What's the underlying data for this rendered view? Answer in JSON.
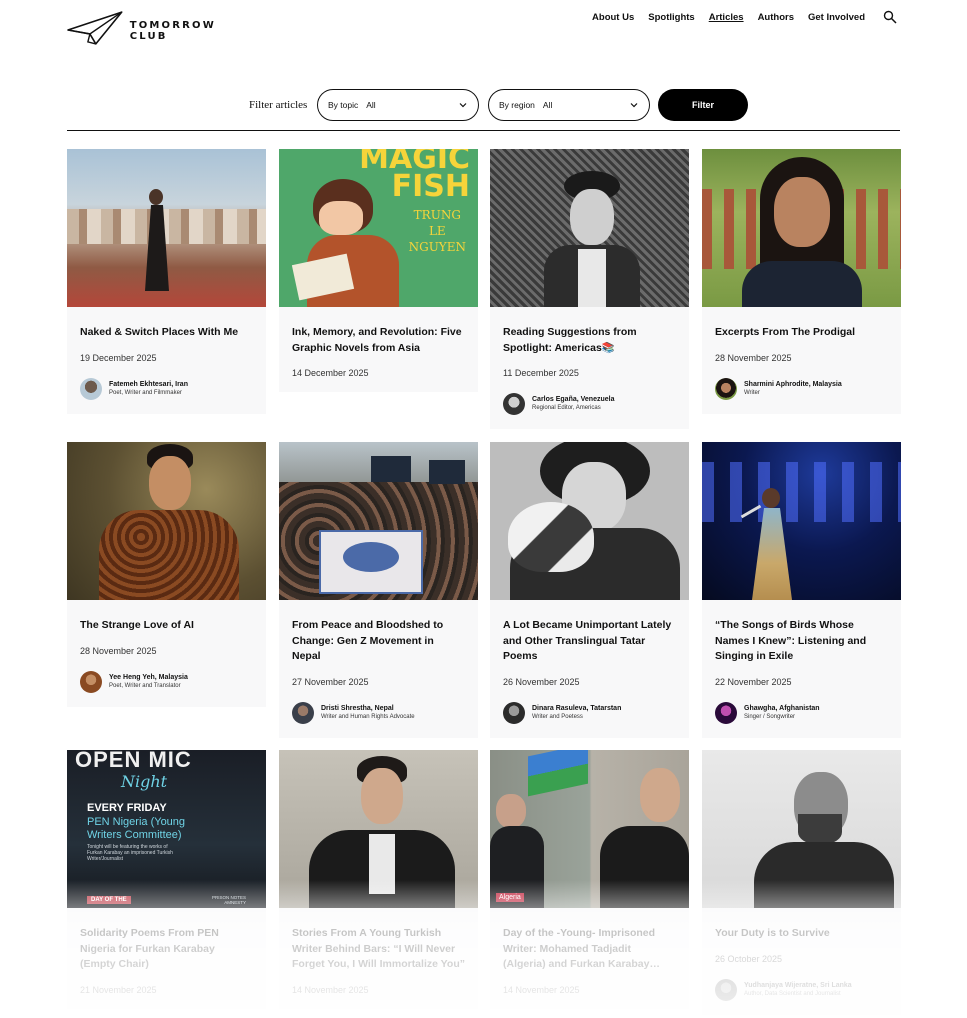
{
  "brand": {
    "line1": "TOMORROW",
    "line2": "CLUB"
  },
  "nav": {
    "items": [
      "About Us",
      "Spotlights",
      "Articles",
      "Authors",
      "Get Involved"
    ],
    "active": "Articles",
    "search_icon": "search-icon"
  },
  "filter": {
    "label": "Filter articles",
    "topic": {
      "label": "By topic",
      "value": "All"
    },
    "region": {
      "label": "By region",
      "value": "All"
    },
    "button": "Filter"
  },
  "cards": [
    {
      "title": "Naked & Switch Places With Me",
      "date": "19 December 2025",
      "author": "Fatemeh Ekhtesari, Iran",
      "role": "Poet, Writer and Filmmaker"
    },
    {
      "title": "Ink, Memory, and Revolution: Five Graphic Novels from Asia",
      "date": "14 December 2025",
      "image_text": [
        "MAGIC",
        "FISH",
        "TRUNG",
        "LE",
        "NGUYEN"
      ]
    },
    {
      "title": "Reading Suggestions from Spotlight: Americas📚",
      "date": "11 December 2025",
      "author": "Carlos Egaña, Venezuela",
      "role": "Regional Editor, Americas"
    },
    {
      "title": "Excerpts From The Prodigal",
      "date": "28 November 2025",
      "author": "Sharmini Aphrodite, Malaysia",
      "role": "Writer"
    },
    {
      "title": "The Strange Love of AI",
      "date": "28 November 2025",
      "author": "Yee Heng Yeh, Malaysia",
      "role": "Poet, Writer and Translator"
    },
    {
      "title": "From Peace and Bloodshed to Change: Gen Z Movement in Nepal",
      "date": "27 November 2025",
      "author": "Dristi Shrestha, Nepal",
      "role": "Writer and Human Rights Advocate"
    },
    {
      "title": "A Lot Became Unimportant Lately and Other Translingual Tatar Poems",
      "date": "26 November 2025",
      "author": "Dinara Rasuleva, Tatarstan",
      "role": "Writer and Poetess"
    },
    {
      "title": "“The Songs of Birds Whose Names I Knew”: Listening and Singing in Exile",
      "date": "22 November 2025",
      "author": "Ghawgha, Afghanistan",
      "role": "Singer / Songwriter"
    },
    {
      "title": "Solidarity Poems From PEN Nigeria for Furkan Karabay (Empty Chair)",
      "date": "21 November 2025",
      "image_text": [
        "OPEN MIC",
        "Night",
        "EVERY FRIDAY",
        "PEN Nigeria (Young",
        "Writers Committee)",
        "Tonight will be featuring the works of",
        "Furkan Karabay an imprisoned Turkish",
        "Writer/Journalist",
        "DAY OF THE",
        "PRISON NOTES",
        "AMNESTY"
      ]
    },
    {
      "title": "Stories From A Young Turkish Writer Behind Bars: “I Will Never Forget You, I Will Immortalize You”",
      "date": "14 November 2025"
    },
    {
      "title": "Day of the -Young- Imprisoned Writer: Mohamed Tadjadit (Algeria) and Furkan Karabay…",
      "date": "14 November 2025",
      "image_tag": "Algeria"
    },
    {
      "title": "Your Duty is to Survive",
      "date": "26 October 2025",
      "author": "Yudhanjaya Wijeratne, Sri Lanka",
      "role": "Author, Data Scientist and Journalist"
    }
  ],
  "colors": {
    "accent": "#000000",
    "card_bg": "#f8f8f9",
    "tag": "#c8394f"
  }
}
